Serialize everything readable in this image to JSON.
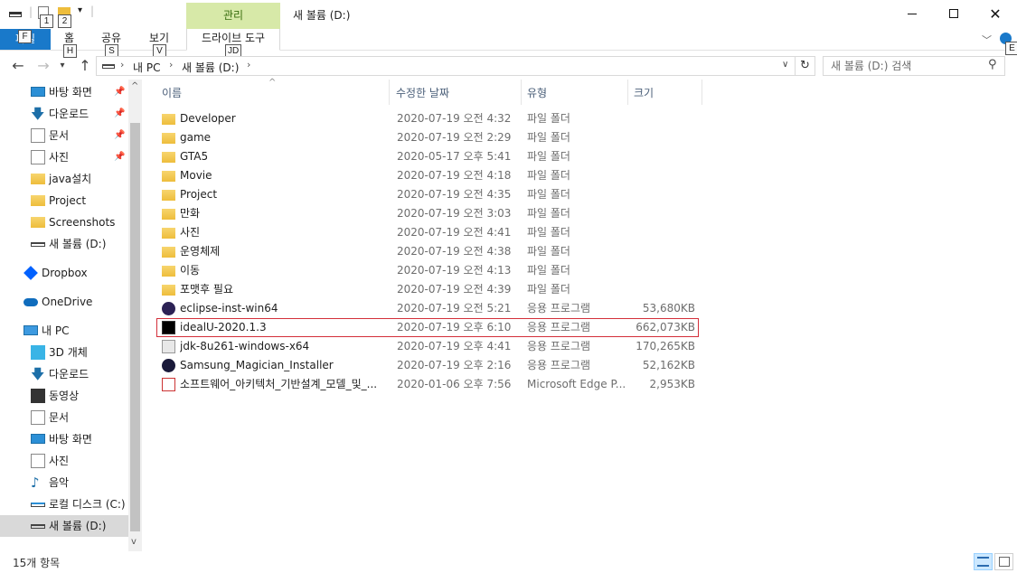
{
  "titlebar": {
    "qa_keytip_1": "1",
    "qa_keytip_2": "2",
    "context_group": "관리",
    "window_title": "새 볼륨 (D:)"
  },
  "ribbon": {
    "file_tab": "파일",
    "file_keytip": "F",
    "tabs": [
      {
        "label": "홈",
        "keytip": "H"
      },
      {
        "label": "공유",
        "keytip": "S"
      },
      {
        "label": "보기",
        "keytip": "V"
      }
    ],
    "drive_tools_tab": "드라이브 도구",
    "drive_tools_keytip": "JD",
    "help_keytip": "E"
  },
  "address": {
    "crumbs": [
      "내 PC",
      "새 볼륨 (D:)"
    ],
    "search_placeholder": "새 볼륨 (D:) 검색"
  },
  "sidebar": {
    "items": [
      {
        "label": "바탕 화면",
        "icon": "desktop-icon",
        "pinned": true
      },
      {
        "label": "다운로드",
        "icon": "download-icon",
        "pinned": true
      },
      {
        "label": "문서",
        "icon": "document-icon",
        "pinned": true
      },
      {
        "label": "사진",
        "icon": "pictures-icon",
        "pinned": true
      },
      {
        "label": "java설치",
        "icon": "folder-icon",
        "pinned": false
      },
      {
        "label": "Project",
        "icon": "folder-icon",
        "pinned": false
      },
      {
        "label": "Screenshots",
        "icon": "folder-icon",
        "pinned": false
      },
      {
        "label": "새 볼륨 (D:)",
        "icon": "drive-icon",
        "pinned": false
      },
      {
        "label": "Dropbox",
        "icon": "dropbox-icon",
        "pinned": false
      },
      {
        "label": "OneDrive",
        "icon": "onedrive-icon",
        "pinned": false
      },
      {
        "label": "내 PC",
        "icon": "pc-icon",
        "pinned": false
      },
      {
        "label": "3D 개체",
        "icon": "3d-objects-icon",
        "pinned": false
      },
      {
        "label": "다운로드",
        "icon": "download-icon",
        "pinned": false
      },
      {
        "label": "동영상",
        "icon": "video-icon",
        "pinned": false
      },
      {
        "label": "문서",
        "icon": "document-icon",
        "pinned": false
      },
      {
        "label": "바탕 화면",
        "icon": "desktop-icon",
        "pinned": false
      },
      {
        "label": "사진",
        "icon": "pictures-icon",
        "pinned": false
      },
      {
        "label": "음악",
        "icon": "music-icon",
        "pinned": false
      },
      {
        "label": "로컬 디스크 (C:)",
        "icon": "local-disk-icon",
        "pinned": false
      },
      {
        "label": "새 볼륨 (D:)",
        "icon": "drive-icon",
        "pinned": false,
        "selected": true
      }
    ]
  },
  "columns": {
    "name": "이름",
    "date": "수정한 날짜",
    "type": "유형",
    "size": "크기"
  },
  "files": [
    {
      "name": "Developer",
      "date": "2020-07-19 오전 4:32",
      "type": "파일 폴더",
      "size": "",
      "icon": "folder-icon"
    },
    {
      "name": "game",
      "date": "2020-07-19 오전 2:29",
      "type": "파일 폴더",
      "size": "",
      "icon": "folder-icon"
    },
    {
      "name": "GTA5",
      "date": "2020-05-17 오후 5:41",
      "type": "파일 폴더",
      "size": "",
      "icon": "folder-icon"
    },
    {
      "name": "Movie",
      "date": "2020-07-19 오전 4:18",
      "type": "파일 폴더",
      "size": "",
      "icon": "folder-icon"
    },
    {
      "name": "Project",
      "date": "2020-07-19 오전 4:35",
      "type": "파일 폴더",
      "size": "",
      "icon": "folder-icon"
    },
    {
      "name": "만화",
      "date": "2020-07-19 오전 3:03",
      "type": "파일 폴더",
      "size": "",
      "icon": "folder-icon"
    },
    {
      "name": "사진",
      "date": "2020-07-19 오전 4:41",
      "type": "파일 폴더",
      "size": "",
      "icon": "folder-icon"
    },
    {
      "name": "운영체제",
      "date": "2020-07-19 오전 4:38",
      "type": "파일 폴더",
      "size": "",
      "icon": "folder-icon"
    },
    {
      "name": "이동",
      "date": "2020-07-19 오전 4:13",
      "type": "파일 폴더",
      "size": "",
      "icon": "folder-icon"
    },
    {
      "name": "포맷후 필요",
      "date": "2020-07-19 오전 4:39",
      "type": "파일 폴더",
      "size": "",
      "icon": "folder-icon"
    },
    {
      "name": "eclipse-inst-win64",
      "date": "2020-07-19 오전 5:21",
      "type": "응용 프로그램",
      "size": "53,680KB",
      "icon": "eclipse-icon"
    },
    {
      "name": "idealU-2020.1.3",
      "date": "2020-07-19 오후 6:10",
      "type": "응용 프로그램",
      "size": "662,073KB",
      "icon": "intellij-icon",
      "highlighted": true
    },
    {
      "name": "jdk-8u261-windows-x64",
      "date": "2020-07-19 오후 4:41",
      "type": "응용 프로그램",
      "size": "170,265KB",
      "icon": "java-installer-icon"
    },
    {
      "name": "Samsung_Magician_Installer",
      "date": "2020-07-19 오후 2:16",
      "type": "응용 프로그램",
      "size": "52,162KB",
      "icon": "samsung-magician-icon"
    },
    {
      "name": "소프트웨어_아키텍처_기반설계_모델_및_...",
      "date": "2020-01-06 오후 7:56",
      "type": "Microsoft Edge P...",
      "size": "2,953KB",
      "icon": "pdf-icon"
    }
  ],
  "status": {
    "item_count": "15개 항목"
  },
  "colors": {
    "file_tab": "#1979ca",
    "context_group": "#d7e9a8",
    "highlight_border": "#d32f3a",
    "folder": "#f0c24a"
  }
}
